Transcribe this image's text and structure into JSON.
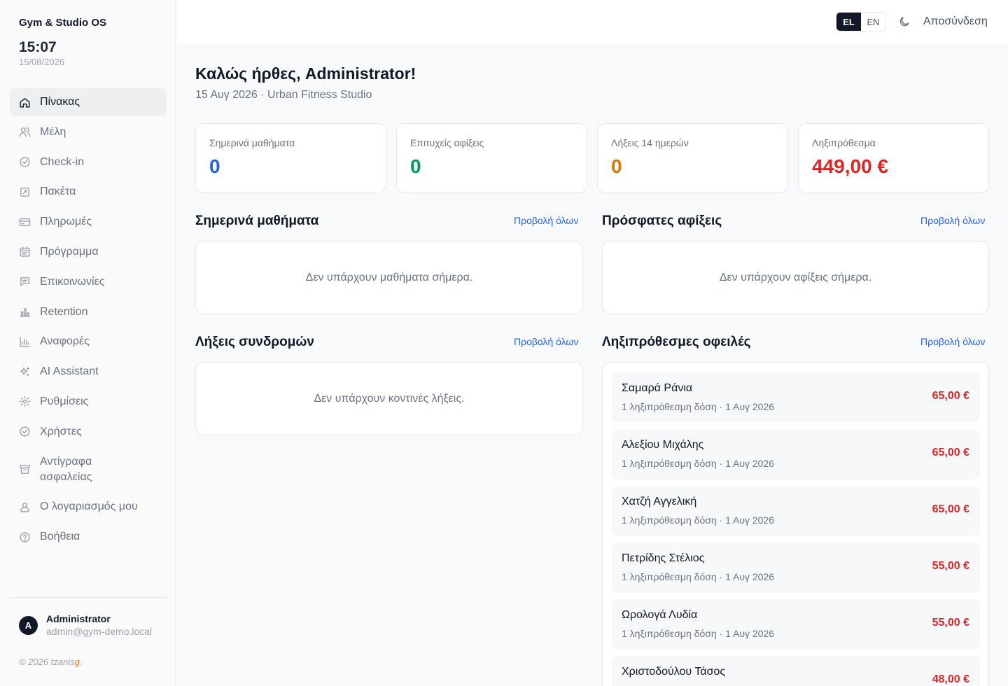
{
  "app": {
    "title": "Gym & Studio OS",
    "time": "15:07",
    "date": "15/08/2026"
  },
  "nav": [
    {
      "label": "Πίνακας",
      "icon": "home-icon",
      "active": true
    },
    {
      "label": "Μέλη",
      "icon": "users-icon"
    },
    {
      "label": "Check-in",
      "icon": "check-circle-icon"
    },
    {
      "label": "Πακέτα",
      "icon": "package-icon"
    },
    {
      "label": "Πληρωμές",
      "icon": "credit-card-icon"
    },
    {
      "label": "Πρόγραμμα",
      "icon": "calendar-icon"
    },
    {
      "label": "Επικοινωνίες",
      "icon": "message-icon"
    },
    {
      "label": "Retention",
      "icon": "bar-chart-icon"
    },
    {
      "label": "Αναφορές",
      "icon": "reports-icon"
    },
    {
      "label": "AI Assistant",
      "icon": "sparkle-icon"
    },
    {
      "label": "Ρυθμίσεις",
      "icon": "gear-icon"
    },
    {
      "label": "Χρήστες",
      "icon": "user-check-icon"
    },
    {
      "label": "Αντίγραφα ασφαλείας",
      "icon": "archive-icon"
    },
    {
      "label": "Ο λογαριασμός μου",
      "icon": "user-icon"
    },
    {
      "label": "Βοήθεια",
      "icon": "help-icon"
    }
  ],
  "user": {
    "initial": "A",
    "name": "Administrator",
    "email": "admin@gym-demo.local"
  },
  "footer": {
    "copyright_prefix": "© 2026 tzanis",
    "copyright_mark": "g",
    "copyright_suffix": "."
  },
  "topbar": {
    "lang_el": "EL",
    "lang_en": "EN",
    "logout": "Αποσύνδεση"
  },
  "header": {
    "greeting": "Καλώς ήρθες, Administrator!",
    "subtitle": "15 Αυγ 2026 · Urban Fitness Studio"
  },
  "stats": [
    {
      "label": "Σημερινά μαθήματα",
      "value": "0",
      "color": "#2563eb"
    },
    {
      "label": "Επιτυχείς αφίξεις",
      "value": "0",
      "color": "#059669"
    },
    {
      "label": "Λήξεις 14 ημερών",
      "value": "0",
      "color": "#d97706"
    },
    {
      "label": "Ληξιπρόθεσμα",
      "value": "449,00 €",
      "color": "#dc2626"
    }
  ],
  "sections": {
    "classes": {
      "title": "Σημερινά μαθήματα",
      "view_all": "Προβολή όλων",
      "empty": "Δεν υπάρχουν μαθήματα σήμερα."
    },
    "arrivals": {
      "title": "Πρόσφατες αφίξεις",
      "view_all": "Προβολή όλων",
      "empty": "Δεν υπάρχουν αφίξεις σήμερα."
    },
    "expirations": {
      "title": "Λήξεις συνδρομών",
      "view_all": "Προβολή όλων",
      "empty": "Δεν υπάρχουν κοντινές λήξεις."
    },
    "overdue": {
      "title": "Ληξιπρόθεσμες οφειλές",
      "view_all": "Προβολή όλων"
    }
  },
  "overdue_list": [
    {
      "name": "Σαμαρά Ράνια",
      "detail": "1 ληξιπρόθεσμη δόση · 1 Αυγ 2026",
      "amount": "65,00 €"
    },
    {
      "name": "Αλεξίου Μιχάλης",
      "detail": "1 ληξιπρόθεσμη δόση · 1 Αυγ 2026",
      "amount": "65,00 €"
    },
    {
      "name": "Χατζή Αγγελική",
      "detail": "1 ληξιπρόθεσμη δόση · 1 Αυγ 2026",
      "amount": "65,00 €"
    },
    {
      "name": "Πετρίδης Στέλιος",
      "detail": "1 ληξιπρόθεσμη δόση · 1 Αυγ 2026",
      "amount": "55,00 €"
    },
    {
      "name": "Ωρολογά Λυδία",
      "detail": "1 ληξιπρόθεσμη δόση · 1 Αυγ 2026",
      "amount": "55,00 €"
    },
    {
      "name": "Χριστοδούλου Τάσος",
      "detail": "",
      "amount": "48,00 €"
    }
  ]
}
